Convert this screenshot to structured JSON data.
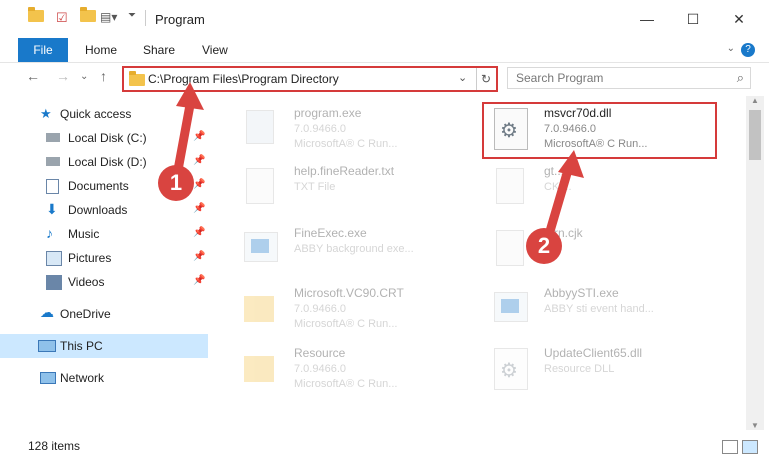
{
  "window": {
    "title": "Program",
    "controls": [
      "—",
      "☐",
      "✕"
    ]
  },
  "ribbon": {
    "tabs": [
      "File",
      "Home",
      "Share",
      "View"
    ],
    "help": "?"
  },
  "address": {
    "path": "C:\\Program Files\\Program Directory",
    "dropdown_icon": "chevron-down-icon",
    "refresh_icon": "refresh-icon"
  },
  "search": {
    "placeholder": "Search Program"
  },
  "nav": {
    "items": [
      {
        "label": "Quick access",
        "icon": "star-icon",
        "pinned": false
      },
      {
        "label": "Local Disk (C:)",
        "icon": "drive-icon",
        "pinned": true
      },
      {
        "label": "Local Disk (D:)",
        "icon": "drive-icon",
        "pinned": true
      },
      {
        "label": "Documents",
        "icon": "document-icon",
        "pinned": true
      },
      {
        "label": "Downloads",
        "icon": "download-icon",
        "pinned": true
      },
      {
        "label": "Music",
        "icon": "music-icon",
        "pinned": true
      },
      {
        "label": "Pictures",
        "icon": "pictures-icon",
        "pinned": true
      },
      {
        "label": "Videos",
        "icon": "videos-icon",
        "pinned": true
      },
      {
        "label": "OneDrive",
        "icon": "cloud-icon",
        "pinned": false
      },
      {
        "label": "This PC",
        "icon": "computer-icon",
        "pinned": false,
        "selected": true
      },
      {
        "label": "Network",
        "icon": "network-icon",
        "pinned": false
      }
    ]
  },
  "files": [
    {
      "name": "program.exe",
      "line2": "7.0.9466.0",
      "line3": "MicrosoftA® C Run...",
      "faded": true
    },
    {
      "name": "msvcr70d.dll",
      "line2": "7.0.9466.0",
      "line3": "MicrosoftA® C Run...",
      "faded": false,
      "highlighted": true
    },
    {
      "name": "help.fineReader.txt",
      "line2": "TXT File",
      "line3": "",
      "faded": true
    },
    {
      "name": "gt...",
      "line2": "CK ...",
      "line3": "",
      "faded": true
    },
    {
      "name": "FineExec.exe",
      "line2": "ABBY background exe...",
      "line3": "",
      "faded": true
    },
    {
      "name": "...rn.cjk",
      "line2": "",
      "line3": "",
      "faded": true
    },
    {
      "name": "Microsoft.VC90.CRT",
      "line2": "7.0.9466.0",
      "line3": "MicrosoftA® C Run...",
      "faded": true
    },
    {
      "name": "AbbyySTI.exe",
      "line2": "ABBY sti event hand...",
      "line3": "",
      "faded": true
    },
    {
      "name": "Resource",
      "line2": "7.0.9466.0",
      "line3": "MicrosoftA® C Run...",
      "faded": true
    },
    {
      "name": "UpdateClient65.dll",
      "line2": "Resource DLL",
      "line3": "",
      "faded": true
    }
  ],
  "annotations": [
    "1",
    "2"
  ],
  "status": {
    "item_count": "128 items"
  },
  "colors": {
    "accent": "#1979ca",
    "highlight_box": "#d53a3a",
    "badge": "#d94440",
    "selected_nav": "#cce8ff"
  }
}
